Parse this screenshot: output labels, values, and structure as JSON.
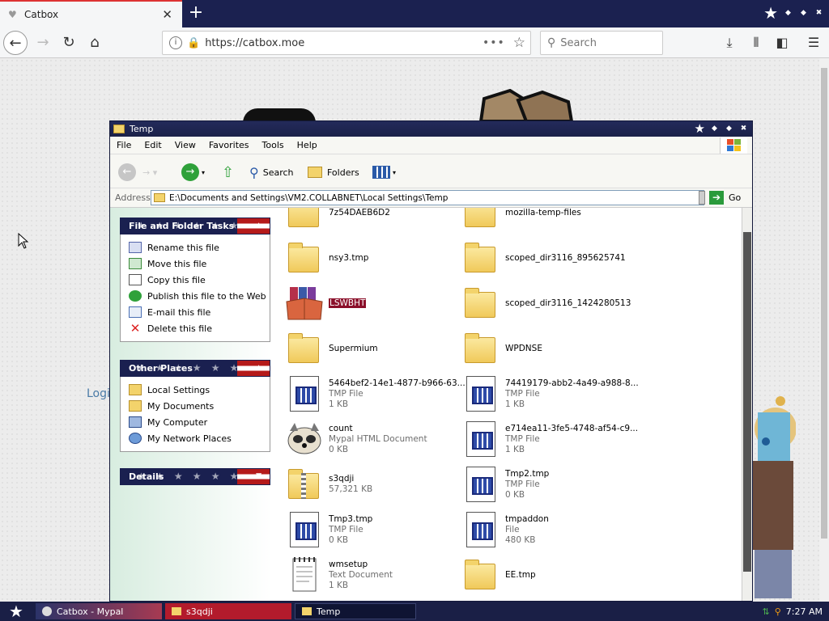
{
  "browser": {
    "tab_title": "Catbox",
    "url": "https://catbox.moe",
    "search_placeholder": "Search"
  },
  "page": {
    "login_text": "Logi"
  },
  "explorer": {
    "title": "Temp",
    "menu": [
      "File",
      "Edit",
      "View",
      "Favorites",
      "Tools",
      "Help"
    ],
    "toolbar": {
      "search": "Search",
      "folders": "Folders"
    },
    "address_label": "Address",
    "address_path": "E:\\Documents and Settings\\VM2.COLLABNET\\Local Settings\\Temp",
    "go_label": "Go",
    "file_tasks": {
      "title": "File and Folder Tasks",
      "items": [
        "Rename this file",
        "Move this file",
        "Copy this file",
        "Publish this file to the Web",
        "E-mail this file",
        "Delete this file"
      ]
    },
    "other_places": {
      "title": "Other Places",
      "items": [
        "Local Settings",
        "My Documents",
        "My Computer",
        "My Network Places"
      ]
    },
    "details": {
      "title": "Details"
    },
    "files": [
      {
        "name": "7z54DAEB6D2",
        "type": "",
        "size": "",
        "icon": "folder-icon"
      },
      {
        "name": "mozilla-temp-files",
        "type": "",
        "size": "",
        "icon": "folder-icon"
      },
      {
        "name": "nsy3.tmp",
        "type": "",
        "size": "",
        "icon": "folder-icon"
      },
      {
        "name": "scoped_dir3116_895625741",
        "type": "",
        "size": "",
        "icon": "folder-icon"
      },
      {
        "name": "LSWBHT",
        "type": "",
        "size": "",
        "icon": "installer-icon"
      },
      {
        "name": "scoped_dir3116_1424280513",
        "type": "",
        "size": "",
        "icon": "folder-icon"
      },
      {
        "name": "Supermium",
        "type": "",
        "size": "",
        "icon": "folder-icon"
      },
      {
        "name": "WPDNSE",
        "type": "",
        "size": "",
        "icon": "folder-icon"
      },
      {
        "name": "5464bef2-14e1-4877-b966-63...",
        "type": "TMP File",
        "size": "1 KB",
        "icon": "tmp-file-icon"
      },
      {
        "name": "74419179-abb2-4a49-a988-8...",
        "type": "TMP File",
        "size": "1 KB",
        "icon": "tmp-file-icon"
      },
      {
        "name": "count",
        "type": "Mypal HTML Document",
        "size": "0 KB",
        "icon": "mypal-icon"
      },
      {
        "name": "e714ea11-3fe5-4748-af54-c9...",
        "type": "TMP File",
        "size": "1 KB",
        "icon": "tmp-file-icon"
      },
      {
        "name": "s3qdji",
        "type": "",
        "size": "57,321 KB",
        "icon": "zip-folder-icon"
      },
      {
        "name": "Tmp2.tmp",
        "type": "TMP File",
        "size": "0 KB",
        "icon": "tmp-file-icon"
      },
      {
        "name": "Tmp3.tmp",
        "type": "TMP File",
        "size": "0 KB",
        "icon": "tmp-file-icon"
      },
      {
        "name": "tmpaddon",
        "type": "File",
        "size": "480 KB",
        "icon": "tmp-file-icon"
      },
      {
        "name": "wmsetup",
        "type": "Text Document",
        "size": "1 KB",
        "icon": "text-doc-icon"
      },
      {
        "name": "EE.tmp",
        "type": "",
        "size": "",
        "icon": "folder-icon"
      }
    ]
  },
  "taskbar": {
    "items": [
      "Catbox - Mypal",
      "s3qdji",
      "Temp"
    ],
    "clock": "7:27 AM"
  },
  "colors": {
    "title_bar": "#1b2149",
    "selection": "#8b0f2a",
    "taskbar": "#1a1f46"
  }
}
